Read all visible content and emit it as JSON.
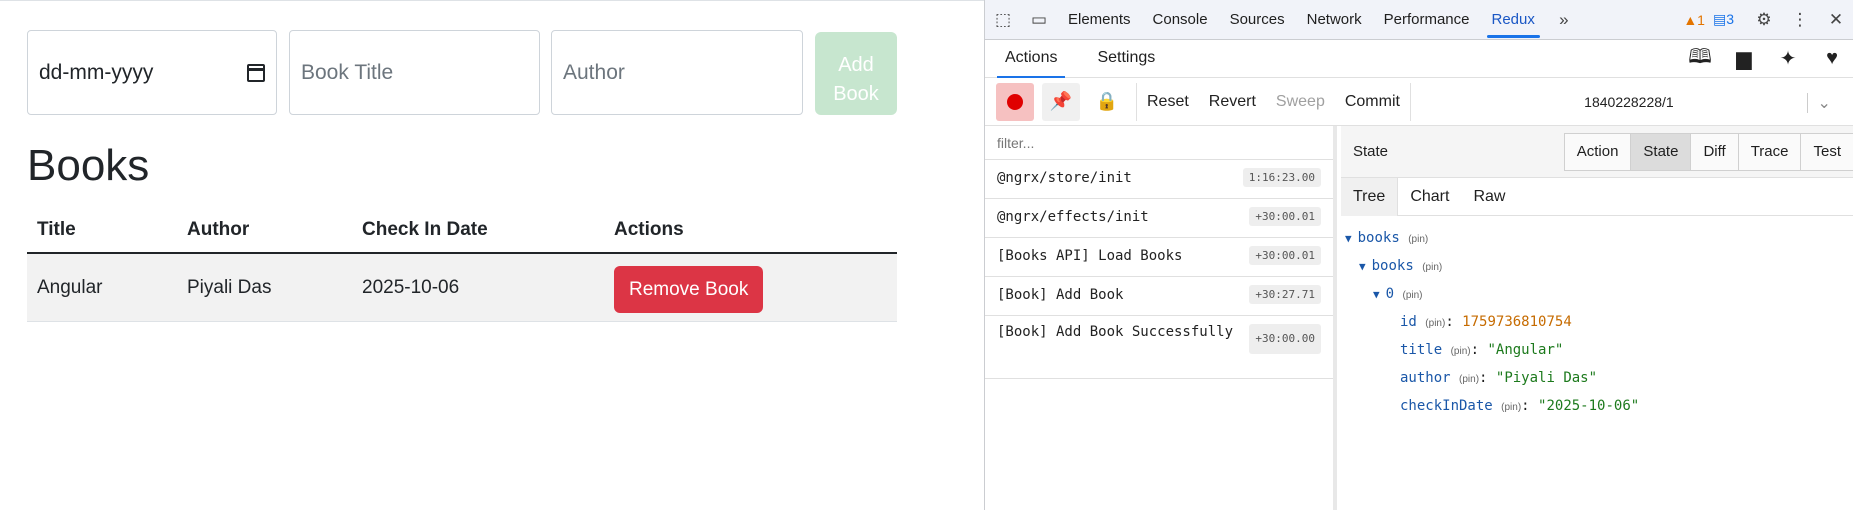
{
  "app": {
    "date_placeholder": "dd-mm-yyyy",
    "title_placeholder": "Book Title",
    "author_placeholder": "Author",
    "add_label_line1": "Add",
    "add_label_line2": "Book",
    "heading": "Books",
    "columns": [
      "Title",
      "Author",
      "Check In Date",
      "Actions"
    ],
    "rows": [
      {
        "title": "Angular",
        "author": "Piyali Das",
        "date": "2025-10-06",
        "action": "Remove Book"
      }
    ]
  },
  "devtools": {
    "tabs": [
      "Elements",
      "Console",
      "Sources",
      "Network",
      "Performance",
      "Redux"
    ],
    "active_tab": "Redux",
    "warnings": "1",
    "messages": "3",
    "redux_tabs": [
      "Actions",
      "Settings"
    ],
    "monitor_buttons": [
      "Reset",
      "Revert",
      "Sweep",
      "Commit"
    ],
    "slider_value": "1840228228/1",
    "filter_placeholder": "filter...",
    "actions": [
      {
        "name": "@ngrx/store/init",
        "time": "1:16:23.00"
      },
      {
        "name": "@ngrx/effects/init",
        "time": "+30:00.01"
      },
      {
        "name": "[Books API] Load Books",
        "time": "+30:00.01"
      },
      {
        "name": "[Book] Add Book",
        "time": "+30:27.71"
      },
      {
        "name": "[Book] Add Book Successfully",
        "time": "+30:00.00"
      }
    ],
    "state_label": "State",
    "state_tabs": [
      "Action",
      "State",
      "Diff",
      "Trace",
      "Test"
    ],
    "view_tabs": [
      "Tree",
      "Chart",
      "Raw"
    ],
    "tree": {
      "root": "books",
      "child": "books",
      "index": "0",
      "pin": "(pin)",
      "id_key": "id",
      "id_val": "1759736810754",
      "title_key": "title",
      "title_val": "\"Angular\"",
      "author_key": "author",
      "author_val": "\"Piyali Das\"",
      "date_key": "checkInDate",
      "date_val": "\"2025-10-06\""
    }
  }
}
